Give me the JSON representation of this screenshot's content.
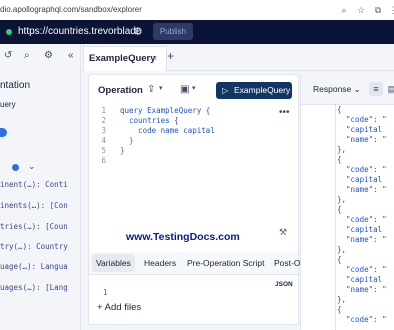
{
  "browser": {
    "url": "dio.apollographql.com/sandbox/explorer",
    "icons": [
      "search-icon",
      "star-icon",
      "extensions-icon",
      "menu-icon"
    ]
  },
  "topbar": {
    "endpoint": "https://countries.trevorblade",
    "publish_label": "Publish",
    "status_color": "#2bd17e"
  },
  "sidebar": {
    "title": "ntation",
    "query_label": "uery",
    "fields": [
      "inent(…): Conti",
      "inents(…): [Con",
      "tries(…): [Coun",
      "try(…): Country",
      "uage(…): Langua",
      "uages(…): [Lang"
    ]
  },
  "tabs": {
    "active": "ExampleQuery",
    "close": "×",
    "add": "+"
  },
  "operation": {
    "label": "Operation",
    "run_label": "ExampleQuery",
    "code_lines": [
      {
        "n": "1",
        "kind": "query",
        "text": "query ExampleQuery {"
      },
      {
        "n": "2",
        "kind": "field",
        "text": "  countries {"
      },
      {
        "n": "3",
        "kind": "field",
        "text": "    code name capital"
      },
      {
        "n": "4",
        "kind": "brace",
        "text": "  }"
      },
      {
        "n": "5",
        "kind": "brace",
        "text": "}"
      },
      {
        "n": "6",
        "kind": "brace",
        "text": ""
      }
    ],
    "watermark": "www.TestingDocs.com"
  },
  "variables": {
    "tabs": [
      "Variables",
      "Headers",
      "Pre-Operation Script",
      "Post-O"
    ],
    "json_label": "JSON",
    "line_number": "1",
    "add_files": "Add files"
  },
  "response": {
    "label": "Response",
    "lines": [
      "{",
      "  \"code\": \"",
      "  \"capital",
      "  \"name\": \"",
      "},",
      "{",
      "  \"code\": \"",
      "  \"capital",
      "  \"name\": \"",
      "},",
      "{",
      "  \"code\": \"",
      "  \"capital",
      "  \"name\": \"",
      "},",
      "{",
      "  \"code\": \"",
      "  \"capital",
      "  \"name\": \"",
      "},",
      "{",
      "  \"code\": \""
    ]
  }
}
